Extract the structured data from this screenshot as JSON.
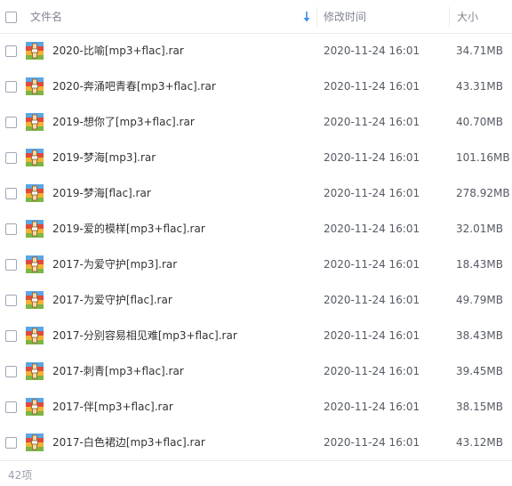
{
  "columns": {
    "name": "文件名",
    "modified": "修改时间",
    "size": "大小"
  },
  "files": [
    {
      "name": "2020-比喻[mp3+flac].rar",
      "modified": "2020-11-24 16:01",
      "size": "34.71MB"
    },
    {
      "name": "2020-奔涌吧青春[mp3+flac].rar",
      "modified": "2020-11-24 16:01",
      "size": "43.31MB"
    },
    {
      "name": "2019-想你了[mp3+flac].rar",
      "modified": "2020-11-24 16:01",
      "size": "40.70MB"
    },
    {
      "name": "2019-梦海[mp3].rar",
      "modified": "2020-11-24 16:01",
      "size": "101.16MB"
    },
    {
      "name": "2019-梦海[flac].rar",
      "modified": "2020-11-24 16:01",
      "size": "278.92MB"
    },
    {
      "name": "2019-爱的模样[mp3+flac].rar",
      "modified": "2020-11-24 16:01",
      "size": "32.01MB"
    },
    {
      "name": "2017-为爱守护[mp3].rar",
      "modified": "2020-11-24 16:01",
      "size": "18.43MB"
    },
    {
      "name": "2017-为爱守护[flac].rar",
      "modified": "2020-11-24 16:01",
      "size": "49.79MB"
    },
    {
      "name": "2017-分别容易相见难[mp3+flac].rar",
      "modified": "2020-11-24 16:01",
      "size": "38.43MB"
    },
    {
      "name": "2017-刺青[mp3+flac].rar",
      "modified": "2020-11-24 16:01",
      "size": "39.45MB"
    },
    {
      "name": "2017-伴[mp3+flac].rar",
      "modified": "2020-11-24 16:01",
      "size": "38.15MB"
    },
    {
      "name": "2017-白色裙边[mp3+flac].rar",
      "modified": "2020-11-24 16:01",
      "size": "43.12MB"
    }
  ],
  "footer": {
    "count": "42项"
  },
  "icons": {
    "file": "rar-archive-icon",
    "sort": "sort-down-arrow-icon"
  },
  "colors": {
    "accent": "#3b8fe8",
    "header_text": "#808590",
    "border": "#e6ebf2"
  }
}
